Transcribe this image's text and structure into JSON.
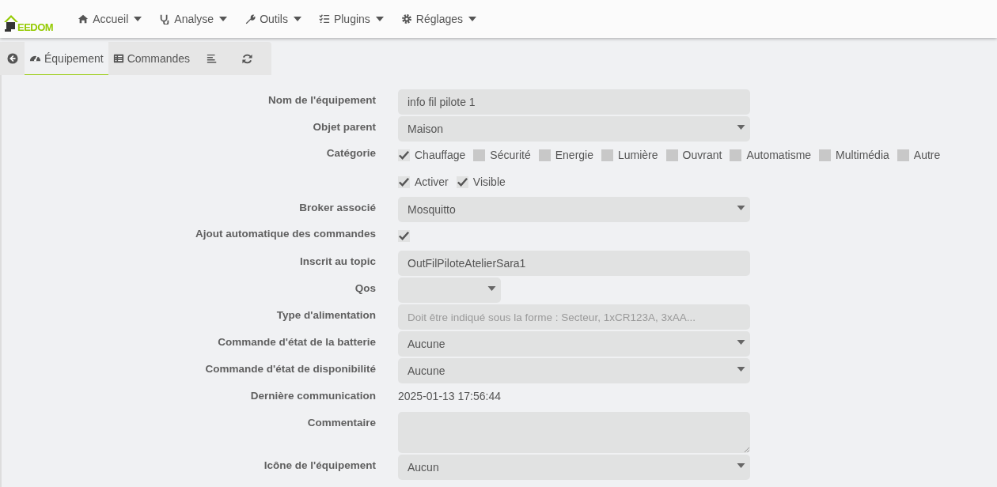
{
  "logo": {
    "text": "EEDOM"
  },
  "nav": [
    {
      "label": "Accueil"
    },
    {
      "label": "Analyse"
    },
    {
      "label": "Outils"
    },
    {
      "label": "Plugins"
    },
    {
      "label": "Réglages"
    }
  ],
  "tabs": [
    {
      "label": "Équipement",
      "selected": true
    },
    {
      "label": "Commandes",
      "selected": false
    }
  ],
  "form": [
    {
      "kind": "text",
      "label": "Nom de l'équipement",
      "value": "info fil pilote 1"
    },
    {
      "kind": "select",
      "label": "Objet parent",
      "value": "Maison"
    },
    {
      "kind": "checks",
      "label": "Catégorie",
      "options": [
        {
          "label": "Chauffage",
          "checked": true
        },
        {
          "label": "Sécurité",
          "checked": false
        },
        {
          "label": "Energie",
          "checked": false
        },
        {
          "label": "Lumière",
          "checked": false
        },
        {
          "label": "Ouvrant",
          "checked": false
        },
        {
          "label": "Automatisme",
          "checked": false
        },
        {
          "label": "Multimédia",
          "checked": false
        },
        {
          "label": "Autre",
          "checked": false
        }
      ]
    },
    {
      "kind": "checks",
      "options": [
        {
          "label": "Activer",
          "checked": true
        },
        {
          "label": "Visible",
          "checked": true
        }
      ]
    },
    {
      "kind": "select",
      "label": "Broker associé",
      "value": "Mosquitto"
    },
    {
      "kind": "checks",
      "label": "Ajout automatique des commandes",
      "options": [
        {
          "checked": true
        }
      ]
    },
    {
      "kind": "text",
      "label": "Inscrit au topic",
      "value": "OutFilPiloteAtelierSara1"
    },
    {
      "kind": "smallselect",
      "label": "Qos"
    },
    {
      "kind": "text",
      "label": "Type d'alimentation",
      "placeholder": "Doit être indiqué sous la forme : Secteur, 1xCR123A, 3xAA..."
    },
    {
      "kind": "select",
      "label": "Commande d'état de la batterie",
      "value": "Aucune"
    },
    {
      "kind": "select",
      "label": "Commande d'état de disponibilité",
      "value": "Aucune"
    },
    {
      "kind": "static",
      "label": "Dernière communication",
      "value": "2025-01-13 17:56:44"
    },
    {
      "kind": "textarea",
      "label": "Commentaire"
    },
    {
      "kind": "select",
      "label": "Icône de l'équipement",
      "value": "Aucun"
    }
  ]
}
